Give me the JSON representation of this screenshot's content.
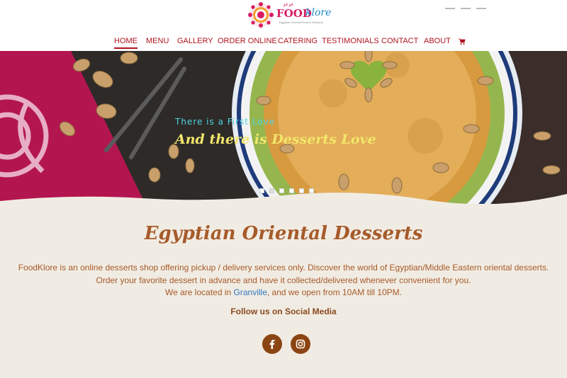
{
  "brand": {
    "logo_food": "FOOD",
    "logo_klore": "klore",
    "logo_tagline": "Egyptian Oriental Food & Desserts",
    "logo_arabic": "ڤو ڤو"
  },
  "nav": {
    "items": [
      "HOME",
      "MENU",
      "GALLERY",
      "ORDER ONLINE",
      "CATERING",
      "TESTIMONIALS",
      "CONTACT",
      "ABOUT"
    ],
    "active": "HOME",
    "cart_icon": "cart-icon"
  },
  "hero": {
    "line1": "There is a First Love",
    "line2": "And there is Desserts Love",
    "slides": 6,
    "active_slide": 2
  },
  "content": {
    "heading": "Egyptian Oriental Desserts",
    "paragraph1": "FoodKlore is an online desserts shop offering pickup / delivery services only. Discover the world of Egyptian/Middle Eastern oriental desserts.",
    "paragraph2": "Order your favorite dessert in advance and have it collected/delivered whenever convenient for you.",
    "paragraph3_before": "We are located in ",
    "paragraph3_link": "Granville",
    "paragraph3_after": ", and we open from 10AM till 10PM.",
    "follow": "Follow us on Social Media"
  },
  "social": [
    "facebook-icon",
    "instagram-icon"
  ],
  "colors": {
    "nav_red": "#b0151f",
    "text_brown": "#a65a2a",
    "link_blue": "#2e78c2",
    "background": "#f1ece3",
    "social_bg": "#8b4513",
    "hero_cyan": "#4fd6e3",
    "hero_yellow": "#f3e66b"
  }
}
